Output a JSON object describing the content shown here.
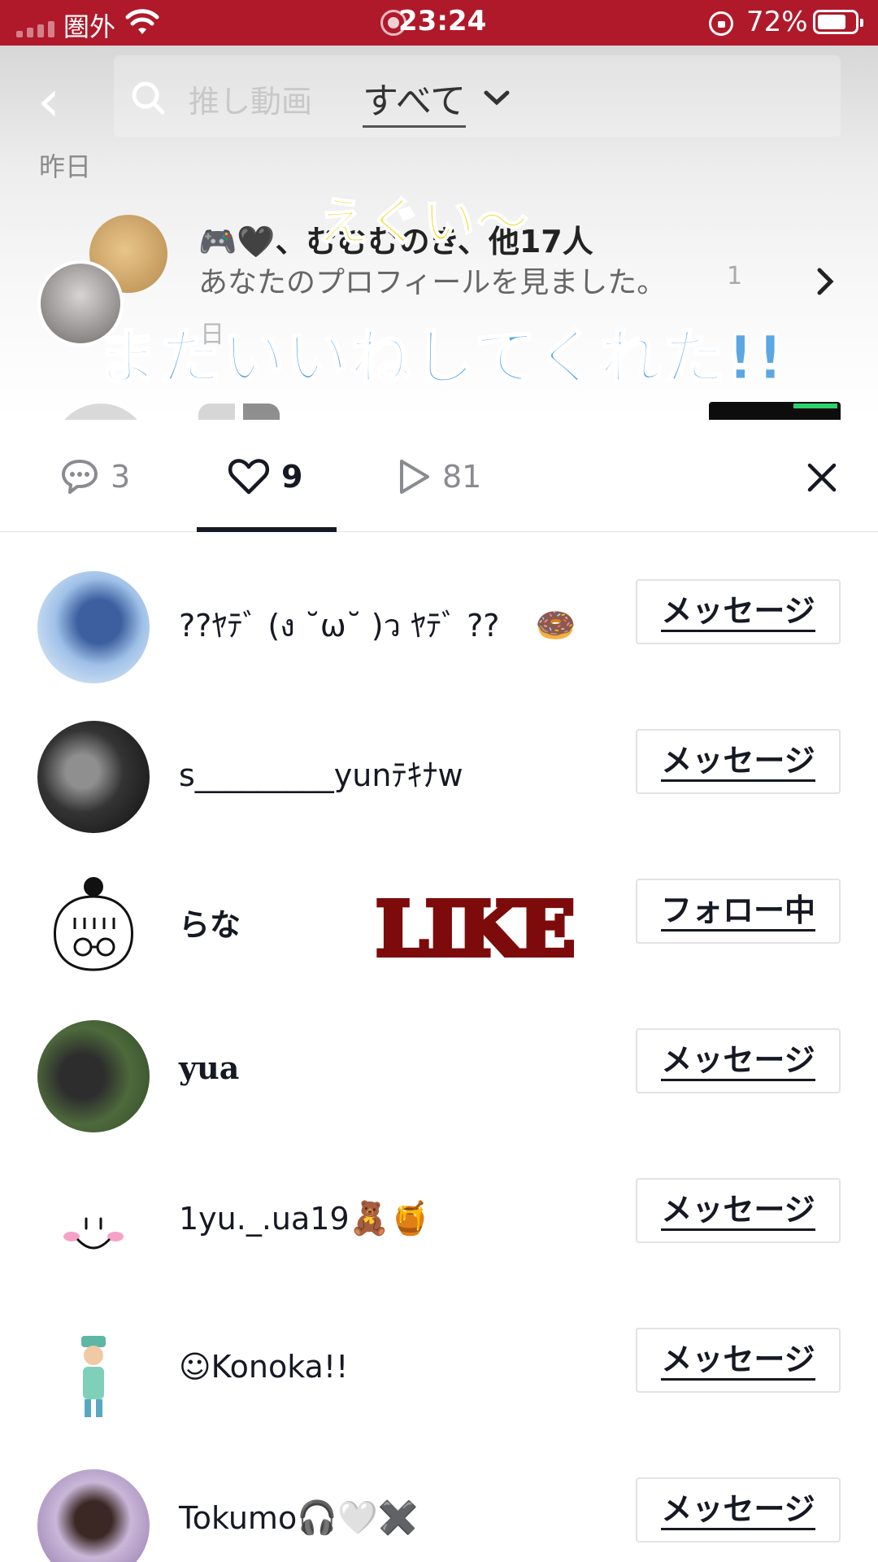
{
  "status_bar": {
    "carrier": "圏外",
    "time": "23:24",
    "battery": "72%"
  },
  "header": {
    "search_placeholder": "推し動画",
    "filter": "すべて"
  },
  "background_inbox": {
    "section": "昨日",
    "notification_title": "🎮🖤、むむむのき、他17人",
    "notification_text": "あなたのプロフィールを見ました。",
    "notification_date": "1",
    "notification_date2": "日"
  },
  "captions": {
    "yellow": "えぐい〜",
    "blue": "またいいねしてくれた!!",
    "like": "LIKE"
  },
  "tabs": {
    "comments": "3",
    "likes": "9",
    "views": "81"
  },
  "users": [
    {
      "name": "??ﾔﾃﾞ (ง ˘ω˘ )ว ﾔﾃﾞ ??",
      "emoji": "🍩",
      "button": "メッセージ"
    },
    {
      "name": "s_________yunﾃｷﾅw",
      "button": "メッセージ"
    },
    {
      "name": "らな",
      "button": "フォロー中"
    },
    {
      "name": "yua",
      "button": "メッセージ"
    },
    {
      "name": "1yu._.ua19",
      "emoji": "🧸🍯",
      "button": "メッセージ"
    },
    {
      "name": "☺︎Konoka!!",
      "button": "メッセージ"
    },
    {
      "name": "Tokumo",
      "emoji": "🎧🤍✖️",
      "button": "メッセージ"
    }
  ],
  "colors": {
    "status_bar": "#b0192a",
    "like_overlay": "#7d0b0b",
    "caption_blue": "#5ba7e3",
    "caption_yellow": "#f1dc3c"
  }
}
